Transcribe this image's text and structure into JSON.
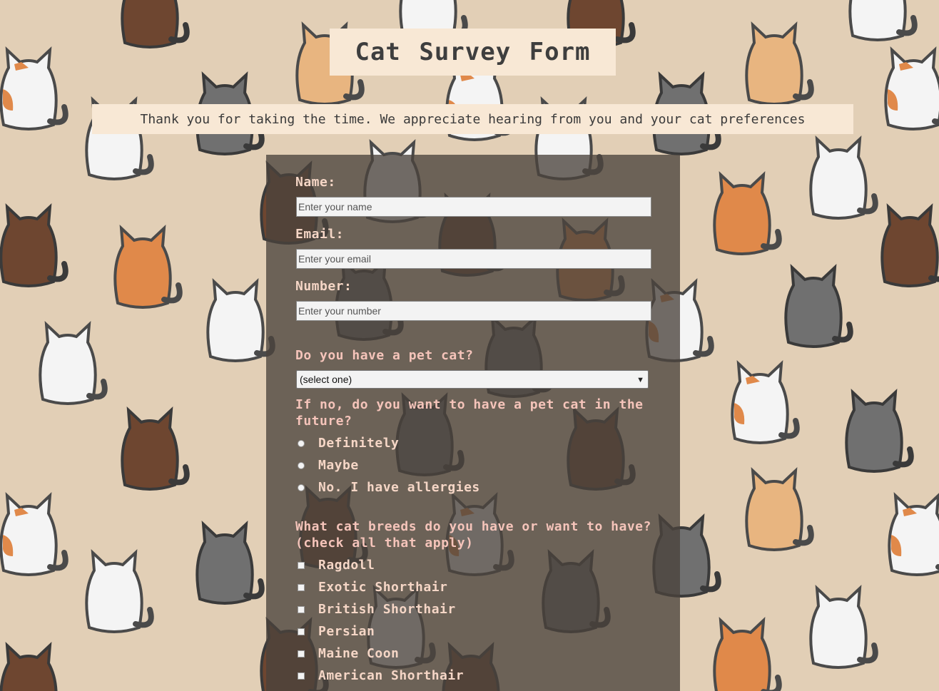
{
  "header": {
    "title": "Cat Survey Form",
    "description": "Thank you for taking the time. We appreciate hearing from you and your cat preferences"
  },
  "form": {
    "name_label": "Name:",
    "name_placeholder": "Enter your name",
    "email_label": "Email:",
    "email_placeholder": "Enter your email",
    "number_label": "Number:",
    "number_placeholder": "Enter your number",
    "pet_question": "Do you have a pet cat?",
    "pet_select_value": "(select one)",
    "future_question": "If no, do you want to have a pet cat in the future?",
    "future_options": [
      "Definitely",
      "Maybe",
      "No. I have allergies"
    ],
    "breeds_question": "What cat breeds do you have or want to have?(check all that apply)",
    "breeds": [
      "Ragdoll",
      "Exotic Shorthair",
      "British Shorthair",
      "Persian",
      "Maine Coon",
      "American Shorthair"
    ]
  },
  "colors": {
    "background": "#e2cfb6",
    "title_box": "#f8e8d5",
    "panel": "#4a423c",
    "label_text": "#f5d6c6"
  },
  "icons": {
    "background_pattern": "cat-icon",
    "select_arrow": "chevron-down-icon"
  }
}
